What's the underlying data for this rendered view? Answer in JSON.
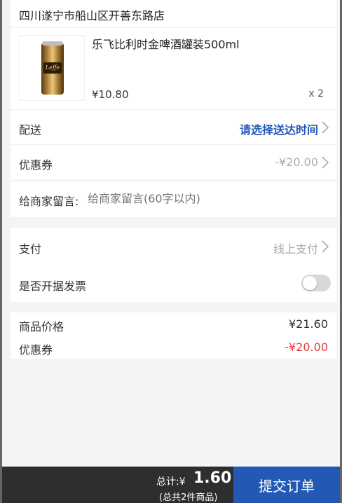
{
  "store": {
    "name": "四川遂宁市船山区开善东路店"
  },
  "product": {
    "name": "乐飞比利时金啤酒罐装500ml",
    "price": "¥10.80",
    "quantity": "x 2",
    "can_label": "Leffe"
  },
  "delivery": {
    "label": "配送",
    "value": "请选择送达时间"
  },
  "coupon": {
    "label": "优惠券",
    "value": "-¥20.00"
  },
  "note": {
    "label": "给商家留言:",
    "placeholder": "给商家留言(60字以内)"
  },
  "payment": {
    "label": "支付",
    "value": "线上支付"
  },
  "invoice": {
    "label": "是否开据发票",
    "enabled": false
  },
  "summary": {
    "goods_price_label": "商品价格",
    "goods_price": "¥21.60",
    "coupon_label": "优惠券",
    "coupon_value": "-¥20.00"
  },
  "footer": {
    "total_label": "总计:¥",
    "total_amount": "1.60",
    "count_text": "(总共2件商品)",
    "submit_label": "提交订单"
  },
  "colors": {
    "accent": "#2359b5",
    "discount": "#e0413c",
    "footer_bg": "#2e2e2e"
  }
}
